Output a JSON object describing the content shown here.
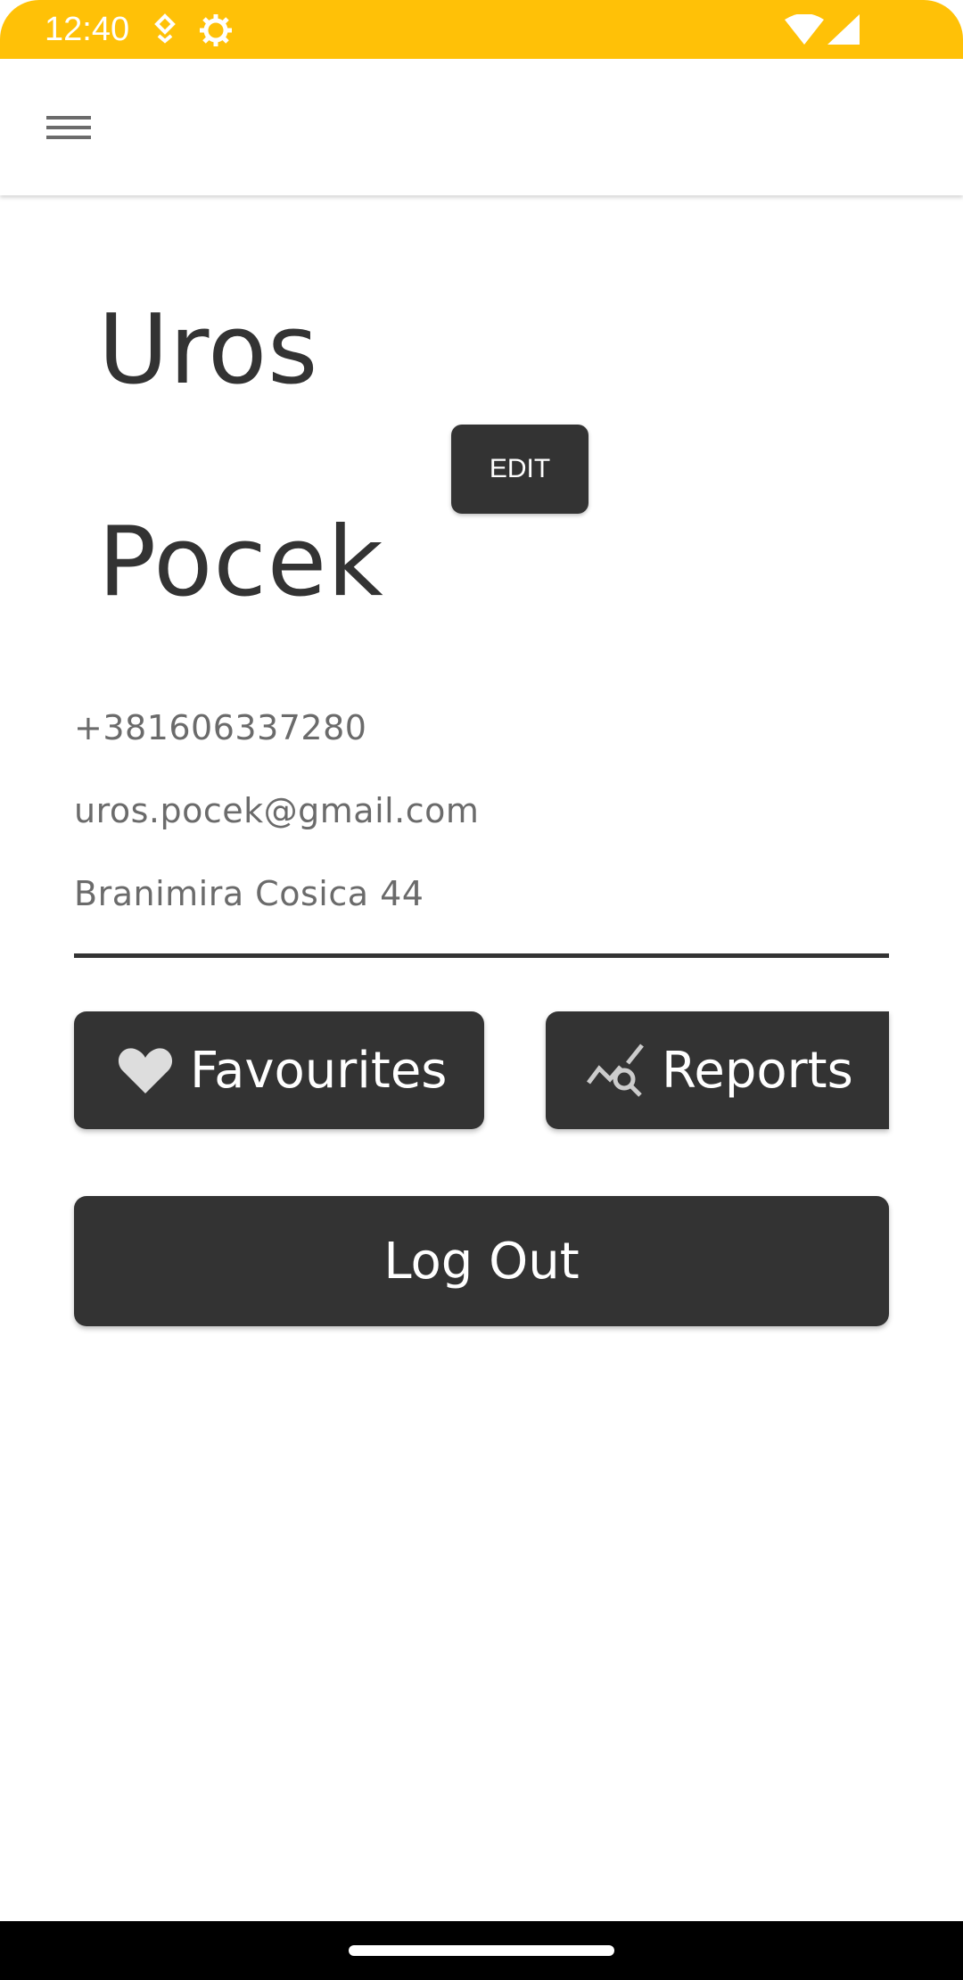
{
  "status_bar": {
    "time": "12:40",
    "background_color": "#FFC107",
    "left_icons": [
      "notification-icon",
      "settings-gear-icon"
    ],
    "right_icons": [
      "wifi-icon",
      "cell-signal-icon"
    ]
  },
  "app_bar": {
    "menu_icon": "hamburger-menu-icon"
  },
  "profile": {
    "first_name": "Uros",
    "last_name": "Pocek",
    "edit_label": "EDIT",
    "phone": "+381606337280",
    "email": "uros.pocek@gmail.com",
    "address": "Branimira Cosica 44"
  },
  "actions": {
    "favourites_label": "Favourites",
    "favourites_icon": "heart-icon",
    "reports_label": "Reports",
    "reports_icon": "chart-search-icon",
    "logout_label": "Log Out"
  },
  "colors": {
    "accent": "#FFC107",
    "button": "#333333",
    "text_primary": "#333333",
    "text_secondary": "#6b6b6b"
  }
}
